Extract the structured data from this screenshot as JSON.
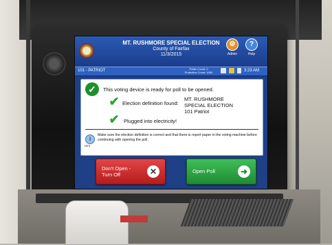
{
  "screen": {
    "header": {
      "title": "MT. RUSHMORE SPECIAL ELECTION",
      "county": "County of Fairfax",
      "date": "11/3/2015",
      "admin_label": "Admin",
      "help_label": "Help"
    },
    "status_bar": {
      "precinct": "101 - PATRIOT",
      "public_count": "Public Count: 0",
      "protective_count": "Protective Count: 1000",
      "time": "3:23 AM"
    },
    "panel": {
      "ready_message": "This voting device is ready for poll to be opened.",
      "definition_label": "Election definition found:",
      "definition_value_line1": "MT. RUSHMORE",
      "definition_value_line2": "SPECIAL ELECTION",
      "definition_value_line3": "101 Patriot",
      "power_label": "Plugged into electricity!",
      "hint_label": "Hint",
      "hint_text": "Make sure the election definition is correct and that there is report paper in the voting machine before continuing with opening the poll."
    },
    "buttons": {
      "dont_open_line1": "Don't Open -",
      "dont_open_line2": "Turn Off",
      "open_poll": "Open Poll"
    }
  },
  "colors": {
    "header_blue": "#1a3c8c",
    "dont_open_red": "#b51c1c",
    "open_poll_green": "#1f8a34",
    "check_green": "#2fa33a"
  },
  "icons": {
    "seal": "county-seal-icon",
    "admin": "admin-icon",
    "help": "help-icon",
    "check": "checkmark-icon",
    "hint": "info-icon",
    "cancel": "x-icon",
    "proceed": "arrow-right-icon"
  }
}
